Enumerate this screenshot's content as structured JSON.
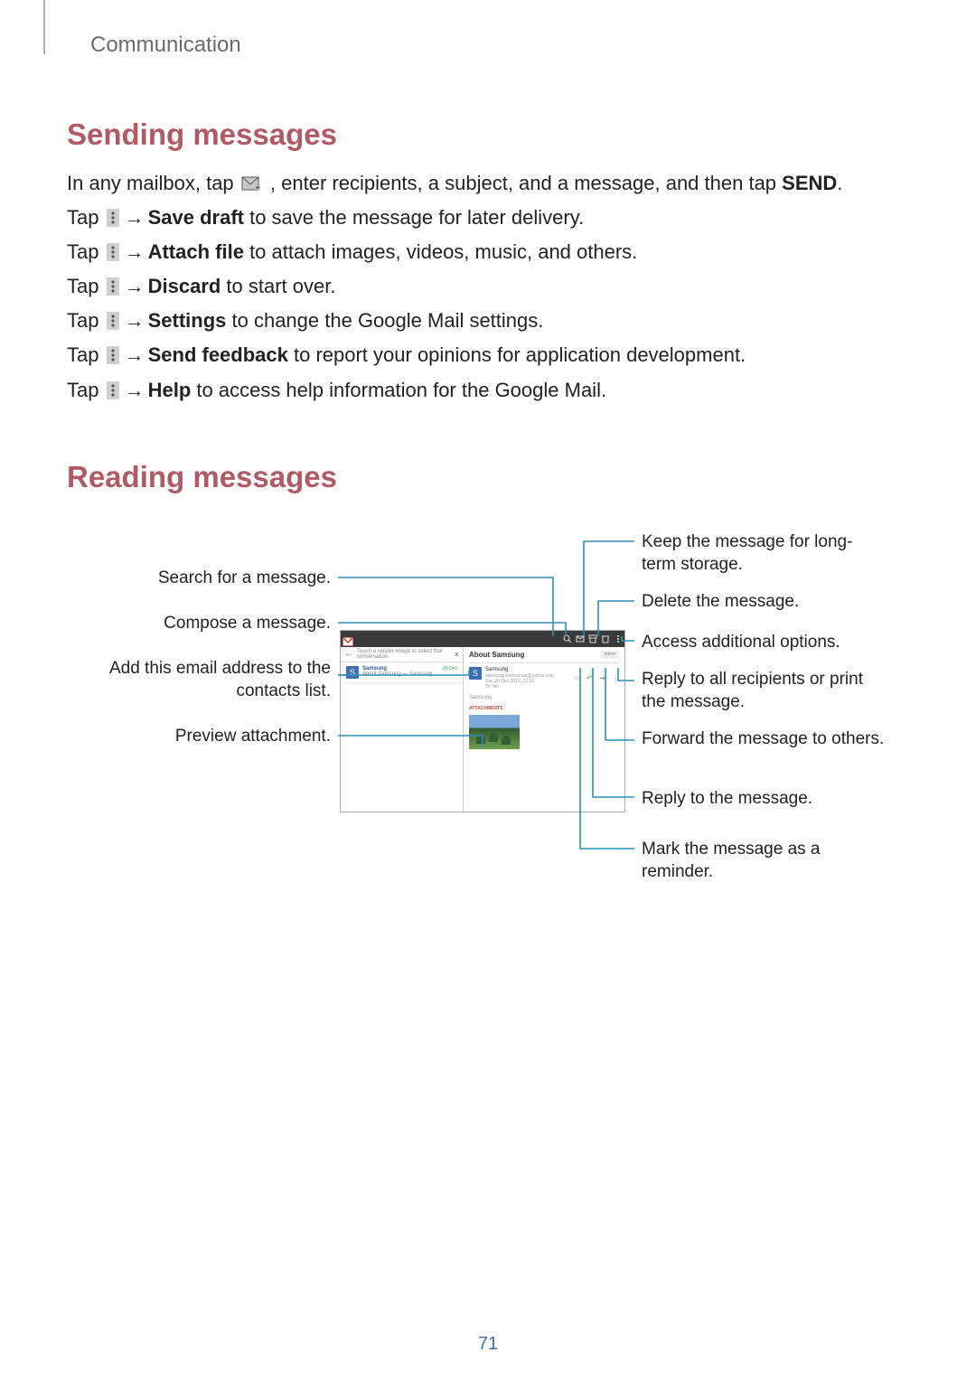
{
  "breadcrumb": "Communication",
  "sections": {
    "sending": {
      "title": "Sending messages",
      "intro_a": "In any mailbox, tap ",
      "intro_b": ", enter recipients, a subject, and a message, and then tap ",
      "intro_send": "SEND",
      "intro_c": ".",
      "lines": [
        {
          "pre": "Tap ",
          "bold": "Save draft",
          "post": " to save the message for later delivery."
        },
        {
          "pre": "Tap ",
          "bold": "Attach file",
          "post": " to attach images, videos, music, and others."
        },
        {
          "pre": "Tap ",
          "bold": "Discard",
          "post": " to start over."
        },
        {
          "pre": "Tap ",
          "bold": "Settings",
          "post": " to change the Google Mail settings."
        },
        {
          "pre": "Tap ",
          "bold": "Send feedback",
          "post": " to report your opinions for application development."
        },
        {
          "pre": "Tap ",
          "bold": "Help",
          "post": " to access help information for the Google Mail."
        }
      ]
    },
    "reading": {
      "title": "Reading messages",
      "left_labels": {
        "search": "Search for a message.",
        "compose": "Compose a message.",
        "add_contact": "Add this email address to the contacts list.",
        "preview": "Preview attachment."
      },
      "right_labels": {
        "keep": "Keep the message for long-term storage.",
        "delete": "Delete the message.",
        "options": "Access additional options.",
        "reply_all": "Reply to all recipients or print the message.",
        "forward": "Forward the message to others.",
        "reply": "Reply to the message.",
        "mark": "Mark the message as a reminder."
      }
    }
  },
  "device": {
    "left_header_text": "Touch a sender image to select that conversation.",
    "label_about": "About Samsung",
    "label_inbox": "Inbox",
    "sender_name": "Samsung",
    "sender_email": "samsungusermanual@yahoo.com",
    "sender_date": "Sat, 26 Dec 2013, 22:10",
    "to_line": "To: me",
    "body_preview_left_name": "Samsung",
    "body_preview_left_sub": "About Samsung — Samsung",
    "body_preview_left_date": "26 Dec",
    "body_text": "Samsung",
    "attachments_label": "ATTACHMENTS"
  },
  "page_number": "71"
}
